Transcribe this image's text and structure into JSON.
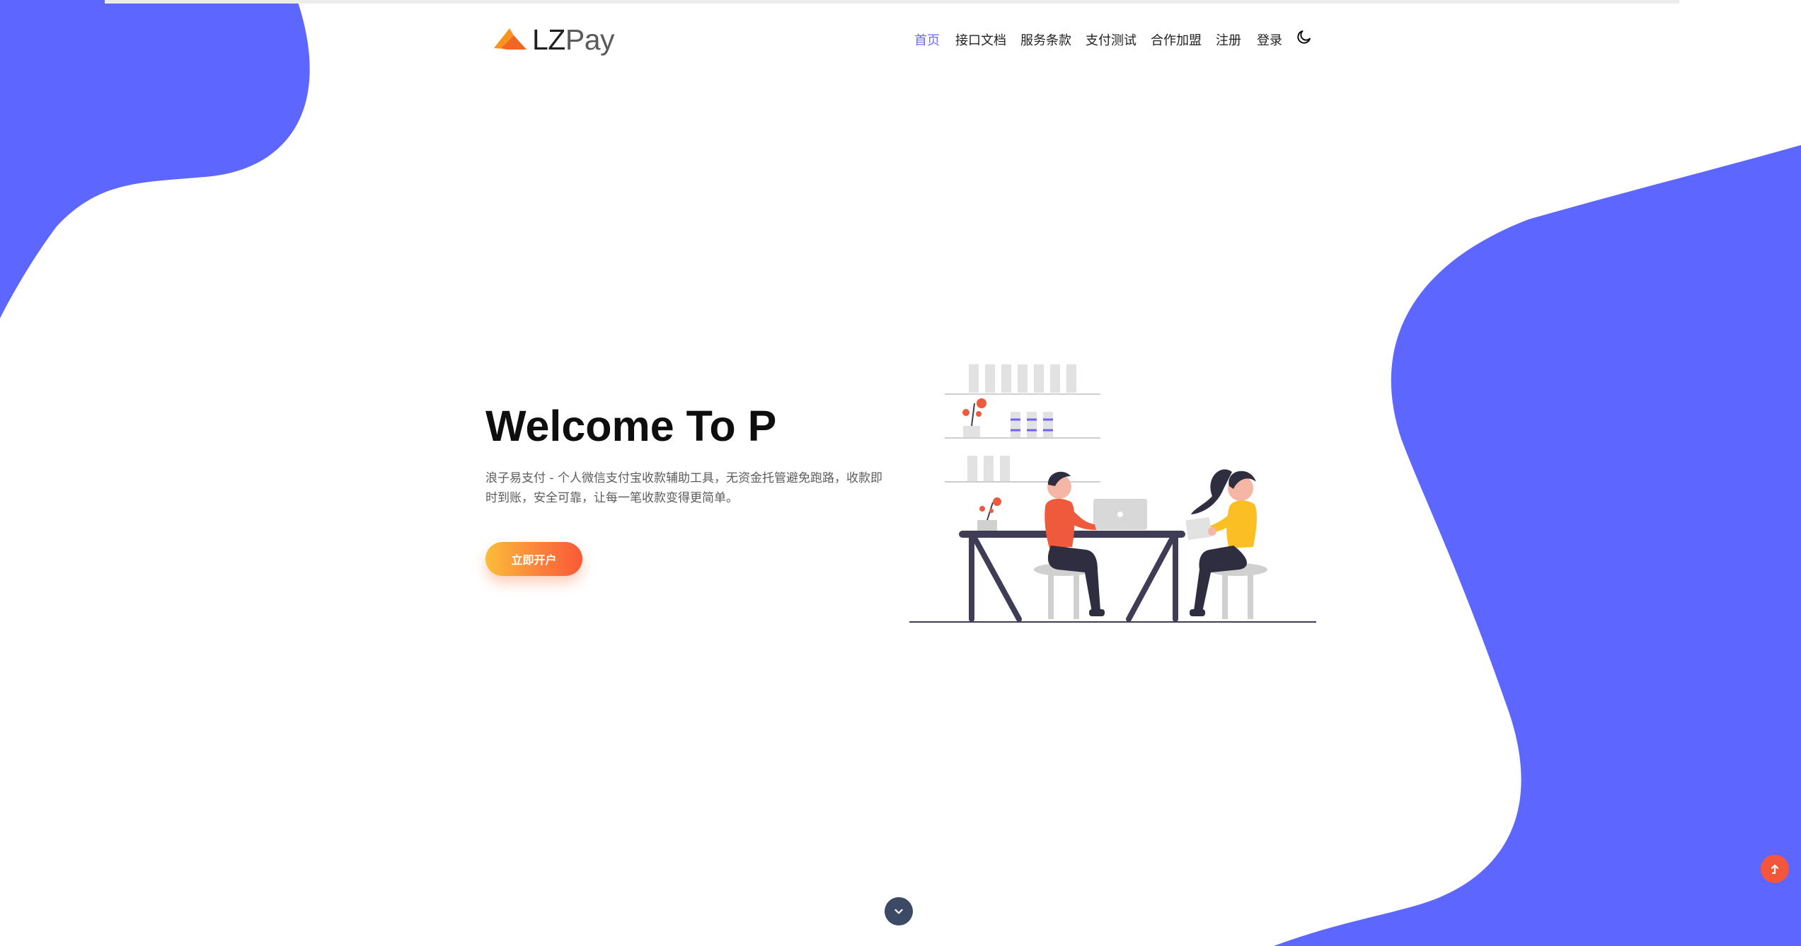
{
  "brand": {
    "name_part1": "LZ",
    "name_part2": "Pay",
    "accent_color": "#6366f1",
    "blob_color": "#5d66ff",
    "logo_icon": "paper-plane-icon"
  },
  "nav": {
    "items": [
      {
        "label": "首页",
        "active": true
      },
      {
        "label": "接口文档",
        "active": false
      },
      {
        "label": "服务条款",
        "active": false
      },
      {
        "label": "支付测试",
        "active": false
      },
      {
        "label": "合作加盟",
        "active": false
      },
      {
        "label": "注册",
        "active": false
      },
      {
        "label": "登录",
        "active": false
      }
    ],
    "theme_toggle_icon": "moon-icon"
  },
  "hero": {
    "title": "Welcome To P",
    "description": "浪子易支付 - 个人微信支付宝收款辅助工具，无资金托管避免跑路，收款即时到账，安全可靠，让每一笔收款变得更简单。",
    "cta_label": "立即开户",
    "cta_gradient": [
      "#fbbd3a",
      "#f95a36"
    ],
    "illustration": "two-people-working-at-desk-illustration"
  },
  "controls": {
    "scroll_down_icon": "chevron-down-icon",
    "back_to_top_icon": "arrow-up-icon",
    "back_to_top_color": "#f4563b"
  }
}
